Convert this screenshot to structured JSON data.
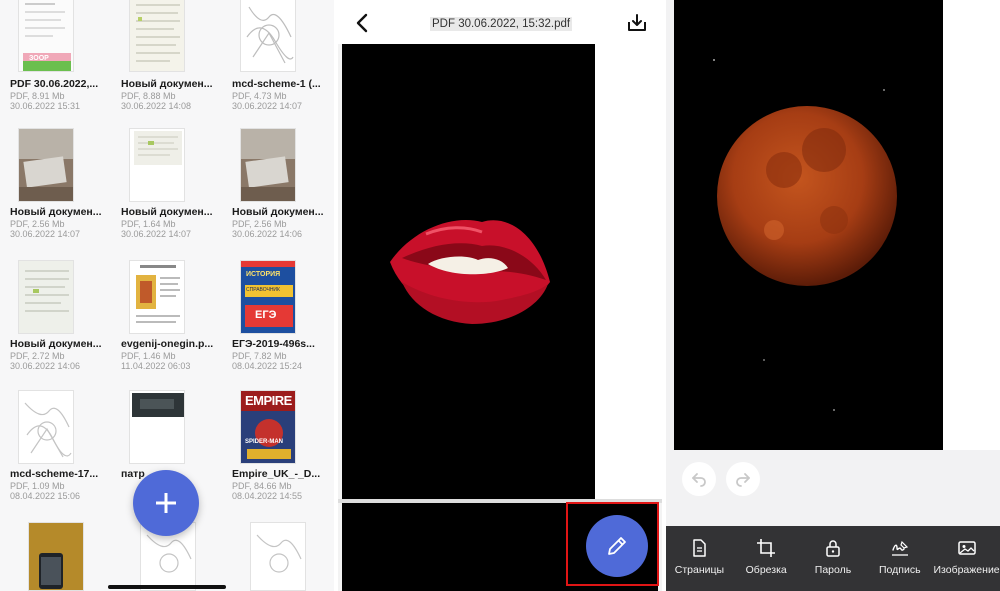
{
  "files": [
    {
      "name": "PDF 30.06.2022,...",
      "meta": "PDF, 8.91 Mb",
      "date": "30.06.2022 15:31"
    },
    {
      "name": "Новый докумен...",
      "meta": "PDF, 8.88 Mb",
      "date": "30.06.2022 14:08"
    },
    {
      "name": "mcd-scheme-1 (...",
      "meta": "PDF, 4.73 Mb",
      "date": "30.06.2022 14:07"
    },
    {
      "name": "Новый докумен...",
      "meta": "PDF, 2.56 Mb",
      "date": "30.06.2022 14:07"
    },
    {
      "name": "Новый докумен...",
      "meta": "PDF, 1.64 Mb",
      "date": "30.06.2022 14:07"
    },
    {
      "name": "Новый докумен...",
      "meta": "PDF, 2.56 Mb",
      "date": "30.06.2022 14:06"
    },
    {
      "name": "Новый докумен...",
      "meta": "PDF, 2.72 Mb",
      "date": "30.06.2022 14:06"
    },
    {
      "name": "evgenij-onegin.p...",
      "meta": "PDF, 1.46 Mb",
      "date": "11.04.2022 06:03"
    },
    {
      "name": "ЕГЭ-2019-496s...",
      "meta": "PDF, 7.82 Mb",
      "date": "08.04.2022 15:24"
    },
    {
      "name": "mcd-scheme-17...",
      "meta": "PDF, 1.09 Mb",
      "date": "08.04.2022 15:06"
    },
    {
      "name": "патр",
      "meta": "",
      "date": ""
    },
    {
      "name": "Empire_UK_-_D...",
      "meta": "PDF, 84.66 Mb",
      "date": "08.04.2022 14:55"
    }
  ],
  "thumb_texts": {
    "promo": "ЗООР",
    "book_title": "ИСТОРИЯ",
    "book_sub": "СПРАВОЧНИК",
    "book_exam": "ЕГЭ",
    "magazine_title": "EMPIRE",
    "magazine_sub": "SPIDER-MAN"
  },
  "viewer": {
    "title": "PDF 30.06.2022, 15:32.pdf"
  },
  "toolbar": [
    {
      "label": "Страницы",
      "icon": "pages-icon"
    },
    {
      "label": "Обрезка",
      "icon": "crop-icon"
    },
    {
      "label": "Пароль",
      "icon": "lock-icon"
    },
    {
      "label": "Подпись",
      "icon": "signature-icon"
    },
    {
      "label": "Изображение",
      "icon": "image-icon"
    }
  ],
  "colors": {
    "accent": "#4f6ad8",
    "highlight": "#e01515",
    "toolbar_bg": "#333335"
  }
}
